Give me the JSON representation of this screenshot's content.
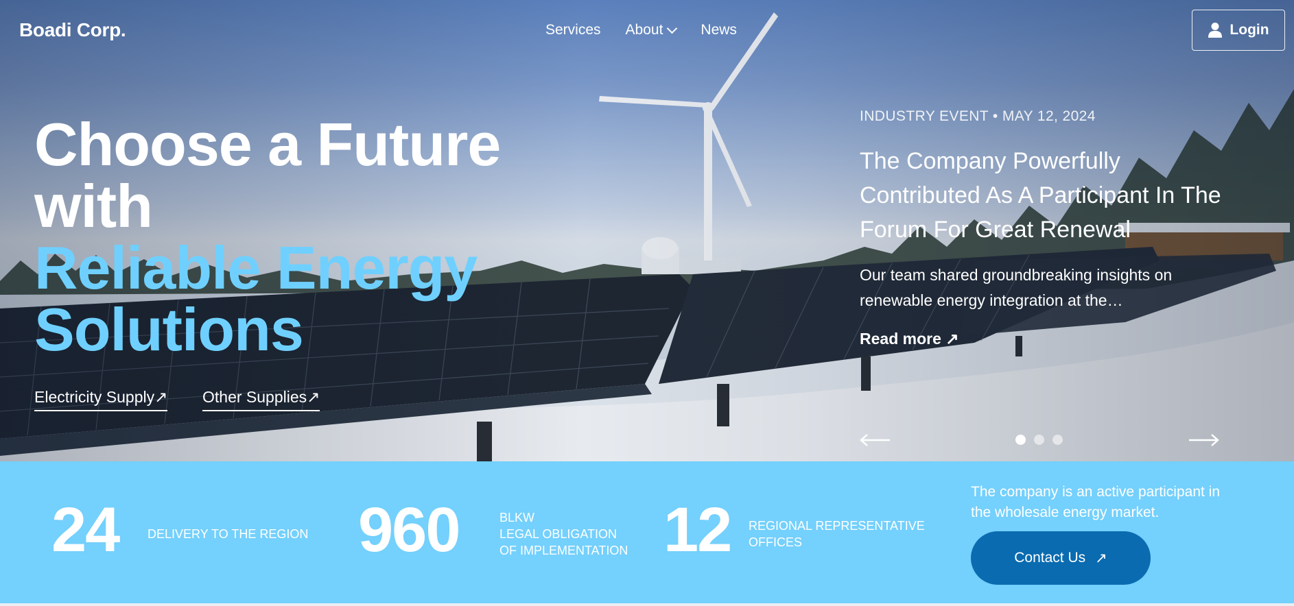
{
  "brand": {
    "name": "Boadi Corp."
  },
  "nav": {
    "items": [
      {
        "label": "Services"
      },
      {
        "label": "About"
      },
      {
        "label": "News"
      }
    ],
    "login_label": "Login"
  },
  "hero": {
    "headline_white": [
      "Choose a Future",
      "with"
    ],
    "headline_blue": [
      "Reliable Energy",
      "Solutions"
    ],
    "links": [
      {
        "label": "Electricity Supply"
      },
      {
        "label": "Other Supplies"
      }
    ],
    "link_arrow": "↗"
  },
  "news": {
    "meta": "INDUSTRY EVENT • MAY 12, 2024",
    "title": "The Company Powerfully Contributed As A Participant In The Forum For Great Renewal",
    "body": "Our team shared groundbreaking insights on renewable energy integration at the…",
    "read_more": "Read more ↗",
    "slides": {
      "count": 3,
      "active": 1
    }
  },
  "stats": {
    "items": [
      {
        "number": "24",
        "label_lines": [
          "DELIVERY TO THE REGION"
        ]
      },
      {
        "number": "960",
        "label_lines": [
          "BLKW",
          "LEGAL OBLIGATION",
          "OF IMPLEMENTATION"
        ]
      },
      {
        "number": "12",
        "label_lines": [
          "REGIONAL REPRESENTATIVE",
          "OFFICES"
        ]
      }
    ],
    "description": "The company is an active participant in the wholesale energy market.",
    "contact_label": "Contact Us",
    "contact_arrow": "↗"
  },
  "colors": {
    "accent_blue": "#6fd0ff",
    "stats_bg": "#74d0fc",
    "button_blue": "#0a6bb0"
  },
  "icons": [
    "user-icon",
    "chevron-down-icon",
    "arrow-up-right-icon",
    "arrow-left-icon",
    "arrow-right-icon"
  ]
}
